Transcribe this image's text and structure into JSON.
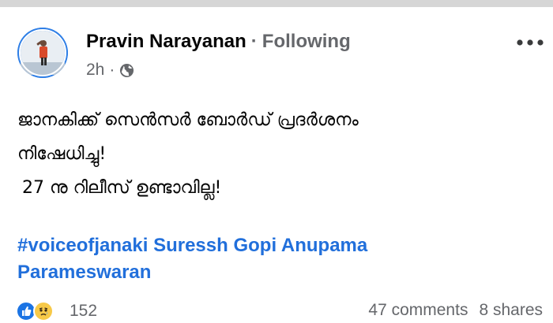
{
  "post": {
    "author": "Pravin Narayanan",
    "separator": "·",
    "follow_status": "Following",
    "timestamp": "2h",
    "meta_separator": "·",
    "audience_icon": "globe-icon",
    "more_icon": "more-options-icon",
    "body_lines": [
      "ജാനകിക്ക് സെൻസർ ബോർഡ് പ്രദർശനം",
      "നിഷേധിച്ചു!",
      "27 നു റിലീസ് ഉണ്ടാവില്ല!"
    ],
    "hashtags_line1": "#voiceofjanaki Suressh Gopi Anupama",
    "hashtags_line2": "Parameswaran"
  },
  "engagement": {
    "reaction_icons": [
      "like-icon",
      "sad-icon"
    ],
    "reaction_count": "152",
    "comments": "47 comments",
    "shares": "8 shares"
  },
  "colors": {
    "link": "#216fdb",
    "secondary_text": "#65676b",
    "like_blue": "#1b74e4",
    "sad_yellow": "#f7c948"
  }
}
